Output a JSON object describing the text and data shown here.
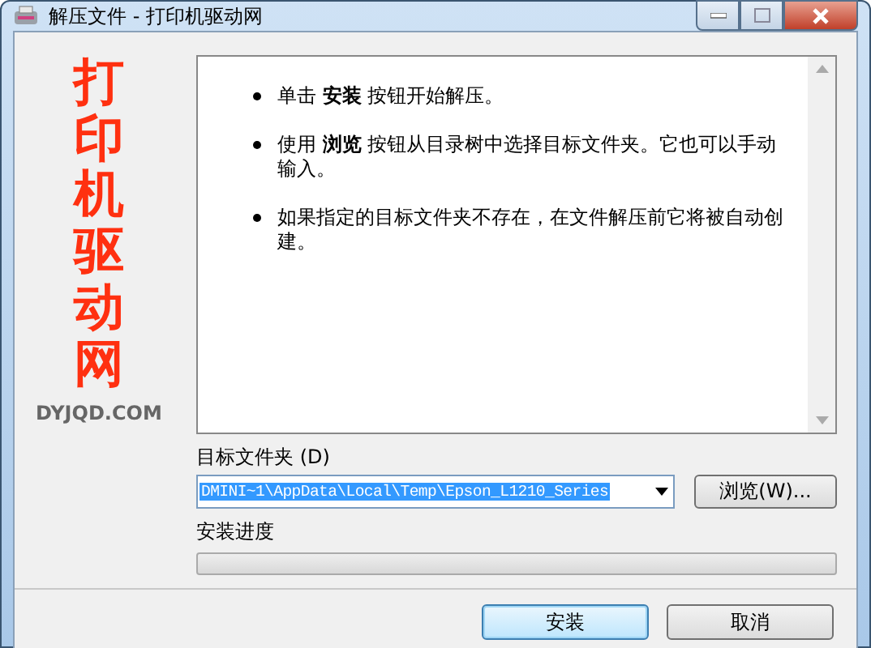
{
  "window": {
    "title": "解压文件 - 打印机驱动网"
  },
  "banner": {
    "title": "打印机驱动网",
    "site": "DYJQD.COM"
  },
  "instructions": [
    "单击 **安装** 按钮开始解压。",
    "使用 **浏览** 按钮从目录树中选择目标文件夹。它也可以手动输入。",
    "如果指定的目标文件夹不存在，在文件解压前它将被自动创建。"
  ],
  "folder": {
    "label": "目标文件夹 (D)",
    "value": "DMINI~1\\AppData\\Local\\Temp\\Epson_L1210_Series",
    "selected": true
  },
  "browse_button": "浏览(W)...",
  "progress": {
    "label": "安装进度",
    "level": 0
  },
  "buttons": [
    {
      "label": "安装",
      "default": true
    },
    {
      "label": "取消",
      "default": false
    }
  ]
}
